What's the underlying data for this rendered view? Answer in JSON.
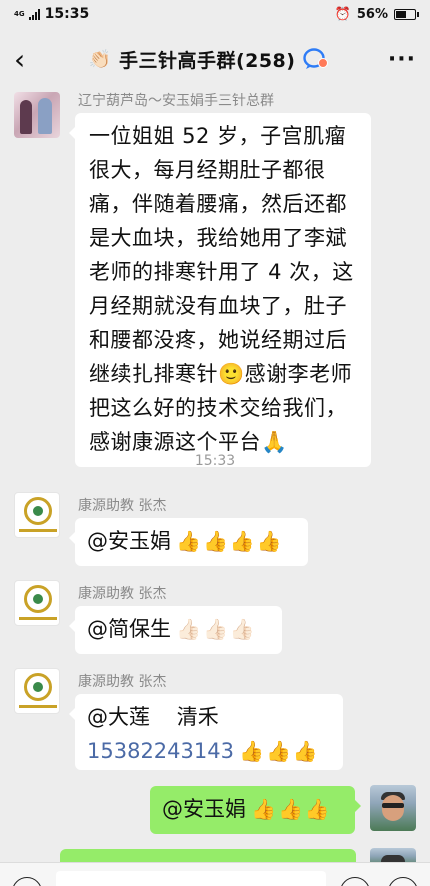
{
  "status_bar": {
    "network": "4G",
    "time": "15:35",
    "battery_percent": "56%",
    "battery_level": 0.56
  },
  "nav": {
    "title": "手三针高手群(258)",
    "leading_emoji": "👏🏻"
  },
  "messages": [
    {
      "sender": "辽宁葫芦岛～安玉娟手三针总群",
      "lines": [
        "一位姐姐 52 岁，子宫肌瘤",
        "很大，每月经期肚子都很",
        "痛，伴随着腰痛，然后还都",
        "是大血块，我给她用了李斌",
        "老师的排寒针用了 4 次，这",
        "月经期就没有血块了，肚子",
        "和腰都没疼，她说经期过后",
        "继续扎排寒针🙂感谢李老师",
        "把这么好的技术交给我们，",
        "感谢康源这个平台🙏"
      ]
    },
    {
      "sender": "康源助教 张杰",
      "mention": "@安玉娟",
      "emojis": "👍👍👍👍"
    },
    {
      "sender": "康源助教 张杰",
      "mention": "@简保生",
      "emojis": "👍🏻👍🏻👍🏻"
    },
    {
      "sender": "康源助教 张杰",
      "mention": "@大莲    清禾",
      "phone": "15382243143",
      "emojis": "👍👍👍"
    },
    {
      "mention": "@安玉娟",
      "emojis": "👍👍👍"
    }
  ],
  "time_separator": "15:33"
}
